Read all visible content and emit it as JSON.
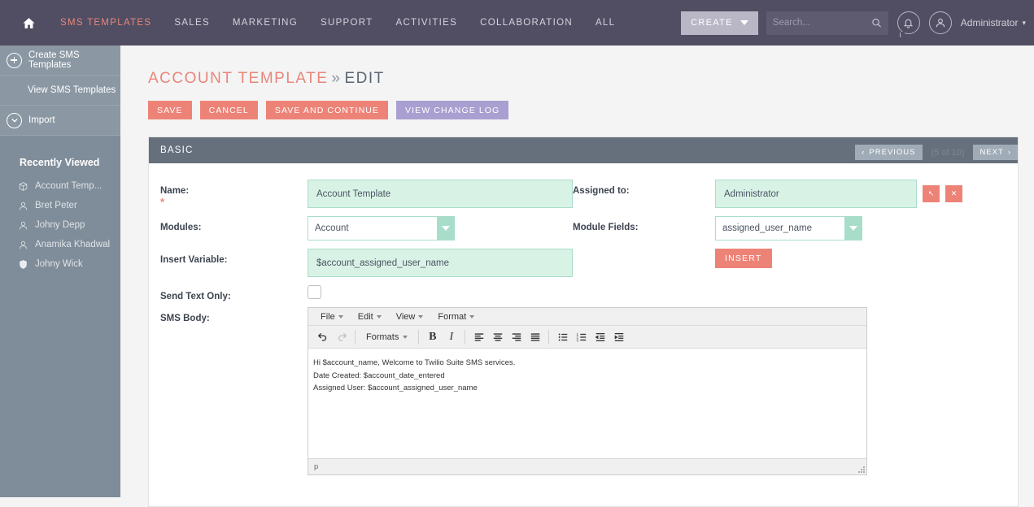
{
  "topnav": {
    "home_icon": "home-icon",
    "items": [
      {
        "label": "SMS Templates",
        "active": true
      },
      {
        "label": "Sales",
        "active": false
      },
      {
        "label": "Marketing",
        "active": false
      },
      {
        "label": "Support",
        "active": false
      },
      {
        "label": "Activities",
        "active": false
      },
      {
        "label": "Collaboration",
        "active": false
      },
      {
        "label": "All",
        "active": false
      }
    ],
    "create_label": "CREATE",
    "search_placeholder": "Search...",
    "search_value": "",
    "user_label": "Administrator",
    "user_caret": "▾"
  },
  "sidebar": {
    "actions": [
      {
        "label": "Create SMS Templates",
        "icon": "circle-plus-icon"
      },
      {
        "label": "View SMS Templates",
        "icon": "none"
      },
      {
        "label": "Import",
        "icon": "circle-down-arrow-icon"
      }
    ],
    "collapse_glyph": "◁",
    "recent_title": "Recently Viewed",
    "recent_items": [
      {
        "label": "Account Temp...",
        "icon": "cube-icon"
      },
      {
        "label": "Bret Peter",
        "icon": "person-icon"
      },
      {
        "label": "Johny Depp",
        "icon": "person-icon"
      },
      {
        "label": "Anamika Khadwal",
        "icon": "person-icon"
      },
      {
        "label": "Johny Wick",
        "icon": "shield-icon"
      }
    ]
  },
  "page": {
    "title_module": "ACCOUNT TEMPLATE",
    "title_sep": "»",
    "title_action": "EDIT",
    "buttons": [
      {
        "label": "SAVE",
        "style": "coral"
      },
      {
        "label": "CANCEL",
        "style": "coral"
      },
      {
        "label": "SAVE AND CONTINUE",
        "style": "coral"
      },
      {
        "label": "VIEW CHANGE LOG",
        "style": "purple"
      }
    ],
    "pager": {
      "previous": "PREVIOUS",
      "next": "NEXT",
      "count": "(5 of 10)",
      "prev_glyph": "‹",
      "next_glyph": "›"
    }
  },
  "panel": {
    "title": "BASIC",
    "collapse_icon": "minus-icon",
    "fields": {
      "name_label": "Name:",
      "name_value": "Account Template",
      "assigned_label": "Assigned to:",
      "assigned_value": "Administrator",
      "assigned_btn1": "↖",
      "assigned_btn2": "✕",
      "modules_label": "Modules:",
      "modules_value": "Account",
      "module_fields_label": "Module Fields:",
      "module_fields_value": "assigned_user_name",
      "insert_variable_label": "Insert Variable:",
      "insert_variable_value": "$account_assigned_user_name",
      "insert_button": "INSERT",
      "send_text_only_label": "Send Text Only:",
      "send_text_only_checked": false,
      "sms_body_label": "SMS Body:"
    }
  },
  "editor": {
    "menus": [
      "File",
      "Edit",
      "View",
      "Format"
    ],
    "formats_label": "Formats",
    "toolbar_icons": [
      "undo-icon",
      "redo-icon",
      "bold-icon",
      "italic-icon",
      "align-left-icon",
      "align-center-icon",
      "align-right-icon",
      "align-justify-icon",
      "bullet-list-icon",
      "numbered-list-icon",
      "outdent-icon",
      "indent-icon"
    ],
    "body_lines": [
      "Hi $account_name, Welcome to Twilio Suite SMS services.",
      "Date Created: $account_date_entered",
      "Assigned User: $account_assigned_user_name"
    ],
    "status_path": "p"
  },
  "colors": {
    "nav_bg": "#514e63",
    "accent_coral": "#ed8377",
    "accent_purple": "#a99fd0",
    "sidebar_bg": "#7f8c99",
    "panel_head": "#66707d",
    "field_green": "#d9f2e6",
    "field_border": "#a8ddca"
  }
}
